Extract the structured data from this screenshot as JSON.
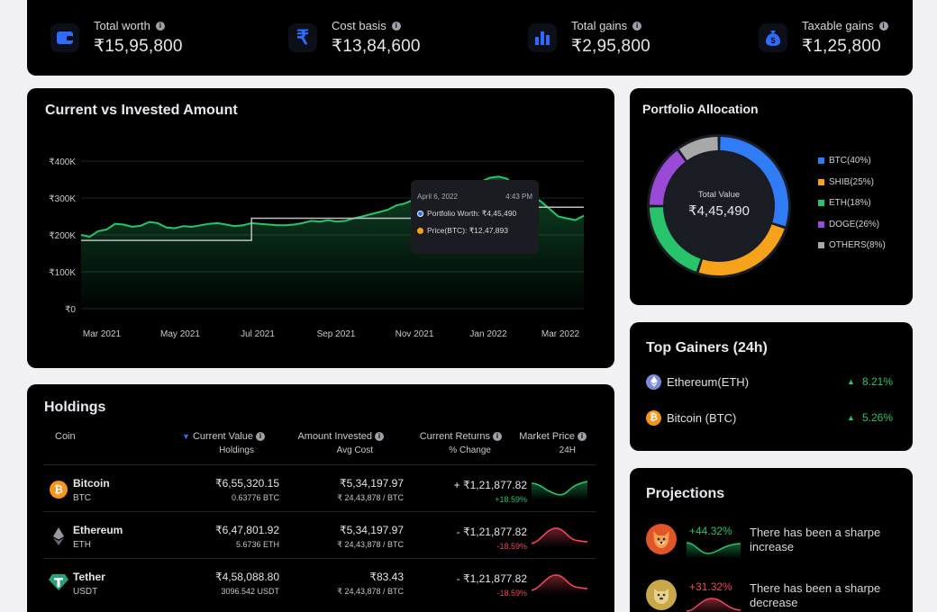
{
  "stats": [
    {
      "label": "Total worth",
      "value": "₹15,95,800",
      "icon": "wallet-icon"
    },
    {
      "label": "Cost basis",
      "value": "₹13,84,600",
      "icon": "rupee-icon"
    },
    {
      "label": "Total gains",
      "value": "₹2,95,800",
      "icon": "bar-chart-icon"
    },
    {
      "label": "Taxable gains",
      "value": "₹1,25,800",
      "icon": "money-bag-icon"
    }
  ],
  "colors": {
    "accent": "#2d6cff",
    "green": "#27c46b",
    "red": "#f0455a",
    "btc": "#2f7cf6",
    "shib": "#f7a21b",
    "eth": "#27c46b",
    "doge": "#9a4ad6",
    "others": "#a8a8a8"
  },
  "chart": {
    "title": "Current vs Invested Amount",
    "tooltip": {
      "date": "April 6, 2022",
      "time": "4:43 PM",
      "worth": "Portfolio Worth: ₹4,45,490",
      "price": "Price(BTC): ₹12,47,893"
    }
  },
  "chart_data": {
    "type": "line",
    "x_labels": [
      "Mar 2021",
      "May 2021",
      "Jul 2021",
      "Sep 2021",
      "Nov 2021",
      "Jan 2022",
      "Mar 2022"
    ],
    "y_ticks": [
      "₹0",
      "₹100K",
      "₹200K",
      "₹300K",
      "₹400K"
    ],
    "ylim": [
      0,
      400000
    ],
    "grid": true,
    "series": [
      {
        "color": "#27c46b",
        "values": [
          200000,
          195000,
          210000,
          215000,
          230000,
          228000,
          222000,
          225000,
          235000,
          232000,
          220000,
          218000,
          224000,
          222000,
          226000,
          230000,
          232000,
          228000,
          224000,
          226000,
          232000,
          230000,
          228000,
          226000,
          226000,
          228000,
          232000,
          238000,
          236000,
          240000,
          236000,
          238000,
          245000,
          250000,
          256000,
          262000,
          268000,
          280000,
          285000,
          295000,
          290000,
          300000,
          305000,
          310000,
          315000,
          320000,
          330000,
          345000,
          355000,
          358000,
          352000,
          330000,
          320000,
          305000,
          290000,
          270000,
          250000,
          245000,
          240000,
          252000
        ]
      },
      {
        "color": "#bfbfc4",
        "step": true,
        "values": [
          185000,
          185000,
          185000,
          185000,
          185000,
          185000,
          185000,
          185000,
          185000,
          185000,
          185000,
          185000,
          185000,
          185000,
          185000,
          185000,
          185000,
          185000,
          185000,
          185000,
          245000,
          245000,
          245000,
          245000,
          245000,
          245000,
          245000,
          245000,
          245000,
          245000,
          245000,
          245000,
          245000,
          245000,
          245000,
          245000,
          245000,
          245000,
          245000,
          245000,
          245000,
          245000,
          245000,
          245000,
          275000,
          275000,
          275000,
          275000,
          275000,
          275000,
          275000,
          275000,
          275000,
          275000,
          275000,
          275000,
          275000,
          275000,
          275000,
          275000
        ]
      }
    ]
  },
  "allocation": {
    "title": "Portfolio Allocation",
    "center_label": "Total Value",
    "center_value": "₹4,45,490",
    "items": [
      {
        "label": "BTC(40%)",
        "color": "#2f7cf6",
        "pct": 30
      },
      {
        "label": "SHIB(25%)",
        "color": "#f7a21b",
        "pct": 25
      },
      {
        "label": "ETH(18%)",
        "color": "#27c46b",
        "pct": 20
      },
      {
        "label": "DOGE(26%)",
        "color": "#9a4ad6",
        "pct": 15
      },
      {
        "label": "OTHERS(8%)",
        "color": "#a8a8a8",
        "pct": 10
      }
    ]
  },
  "gainers": {
    "title": "Top Gainers (24h)",
    "items": [
      {
        "name": "Ethereum(ETH)",
        "change": "8.21%",
        "icon": "ethereum-icon"
      },
      {
        "name": "Bitcoin (BTC)",
        "change": "5.26%",
        "icon": "bitcoin-icon"
      }
    ]
  },
  "projections": {
    "title": "Projections",
    "items": [
      {
        "pct": "+44.32%",
        "text": "There has been a sharpe increase",
        "trend": "up",
        "icon": "shiba-icon"
      },
      {
        "pct": "+31.32%",
        "text": "There has been a sharpe decrease",
        "trend": "down",
        "icon": "doge-icon"
      }
    ]
  },
  "holdings": {
    "title": "Holdings",
    "headers": {
      "coin": "Coin",
      "current_value": "Current Value",
      "current_value_sub": "Holdings",
      "amount_invested": "Amount Invested",
      "amount_invested_sub": "Avg Cost",
      "current_returns": "Current Returns",
      "current_returns_sub": "% Change",
      "market_price": "Market Price",
      "market_price_sub": "24H"
    },
    "rows": [
      {
        "name": "Bitcoin",
        "symbol": "BTC",
        "icon": "bitcoin-icon",
        "value": "₹6,55,320.15",
        "holdings": "0.63776 BTC",
        "invested": "₹5,34,197.97",
        "avg_cost": "₹ 24,43,878 / BTC",
        "returns": "+ ₹1,21,877.82",
        "change": "+18.59%",
        "trend": "up"
      },
      {
        "name": "Ethereum",
        "symbol": "ETH",
        "icon": "ethereum-icon",
        "value": "₹6,47,801.92",
        "holdings": "5.6736 ETH",
        "invested": "₹5,34,197.97",
        "avg_cost": "₹ 24,43,878 / BTC",
        "returns": "- ₹1,21,877.82",
        "change": "-18.59%",
        "trend": "down"
      },
      {
        "name": "Tether",
        "symbol": "USDT",
        "icon": "tether-icon",
        "value": "₹4,58,088.80",
        "holdings": "3096.542 USDT",
        "invested": "₹83.43",
        "avg_cost": "₹ 24,43,878 / BTC",
        "returns": "- ₹1,21,877.82",
        "change": "-18.59%",
        "trend": "down"
      }
    ]
  }
}
